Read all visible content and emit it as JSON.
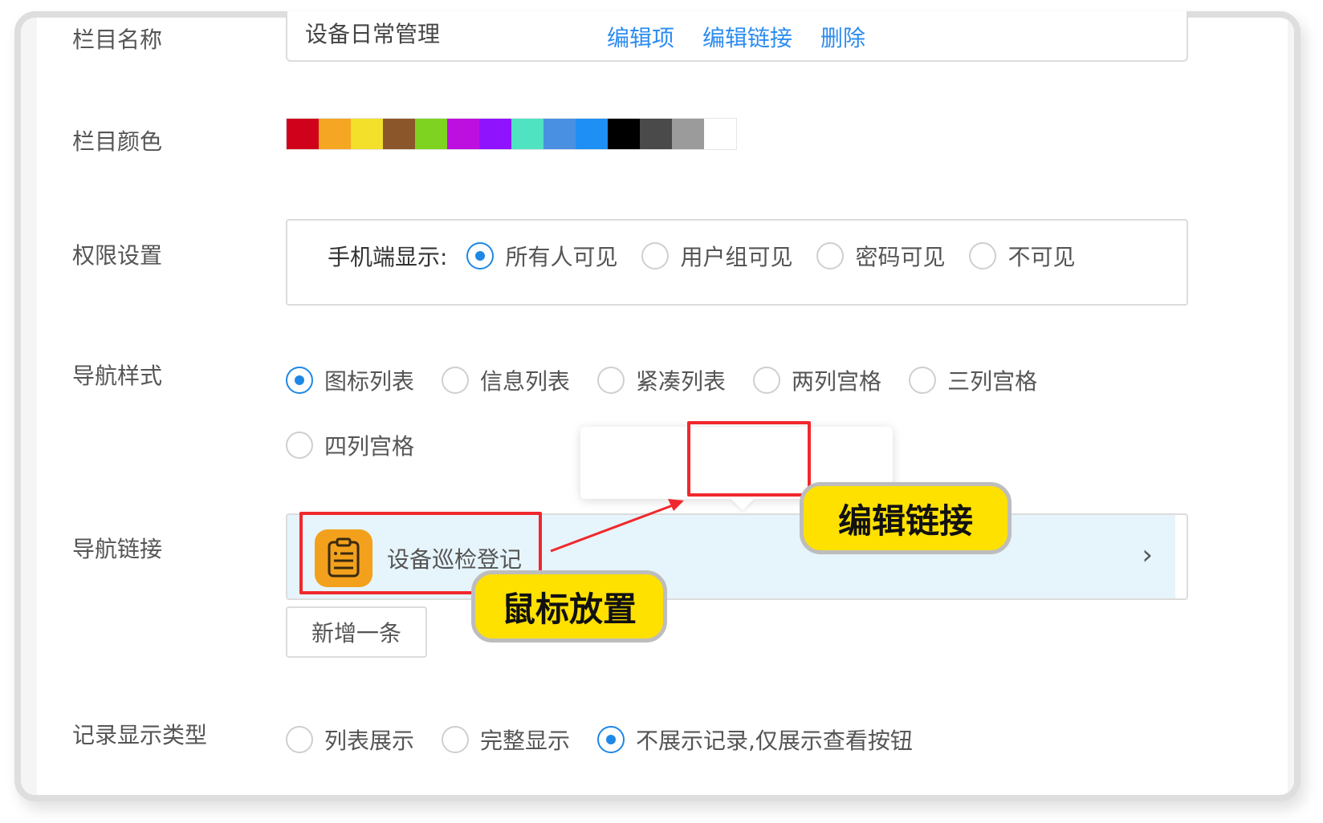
{
  "form": {
    "name_label": "栏目名称",
    "name_value": "设备日常管理",
    "color_label": "栏目颜色",
    "colors": [
      "#d0021b",
      "#f5a623",
      "#f2e02a",
      "#8b572a",
      "#7ed321",
      "#bd10e0",
      "#9013fe",
      "#50e3c2",
      "#4a90e2",
      "#1e8ff5",
      "#000000",
      "#4a4a4a",
      "#9b9b9b",
      "#ffffff"
    ],
    "permission_label": "权限设置",
    "permission": {
      "title": "手机端显示:",
      "options": [
        "所有人可见",
        "用户组可见",
        "密码可见",
        "不可见"
      ],
      "selected": "所有人可见"
    },
    "nav_style_label": "导航样式",
    "nav_style": {
      "options": [
        "图标列表",
        "信息列表",
        "紧凑列表",
        "两列宫格",
        "三列宫格",
        "四列宫格"
      ],
      "selected": "图标列表"
    },
    "nav_link_label": "导航链接",
    "nav_link": {
      "item_text": "设备巡检登记",
      "icon": "document-icon",
      "chevron": "›"
    },
    "popover": {
      "edit_item": "编辑项",
      "edit_link": "编辑链接",
      "delete": "删除"
    },
    "add_button": "新增一条",
    "record_type_label": "记录显示类型",
    "record_type": {
      "options": [
        "列表展示",
        "完整显示",
        "不展示记录,仅展示查看按钮"
      ],
      "selected": "不展示记录,仅展示查看按钮"
    }
  },
  "annotations": {
    "hover_callout": "鼠标放置",
    "edit_link_callout": "编辑链接"
  },
  "colors": {
    "accent": "#1e88e5",
    "link": "#2d8cf0",
    "highlight": "#f0282d",
    "callout_bg": "#ffe100",
    "nav_item_bg": "#e6f4fb",
    "icon_bg": "#f3a11c"
  }
}
